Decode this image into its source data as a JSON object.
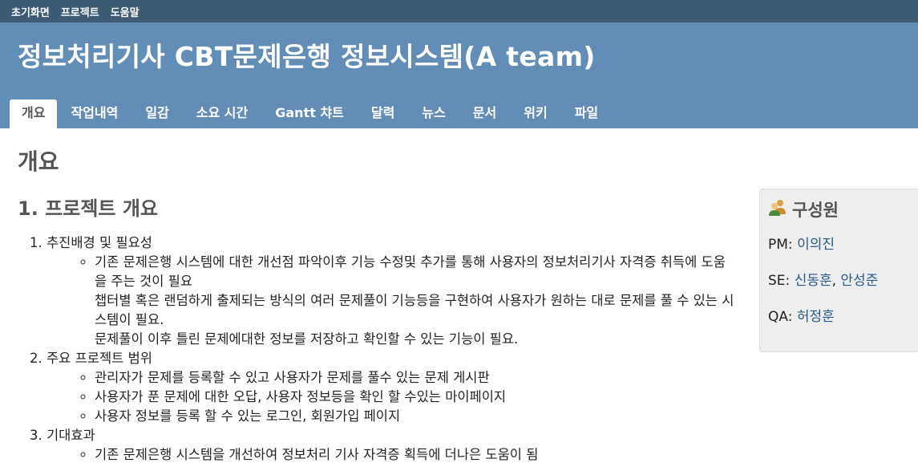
{
  "top_menu": [
    "초기화면",
    "프로젝트",
    "도움말"
  ],
  "header": {
    "title": "정보처리기사 CBT문제은행 정보시스템(A team)"
  },
  "main_menu": {
    "tabs": [
      "개요",
      "작업내역",
      "일감",
      "소요 시간",
      "Gantt 챠트",
      "달력",
      "뉴스",
      "문서",
      "위키",
      "파일"
    ],
    "selected": "개요"
  },
  "content": {
    "page_title": "개요",
    "section_title": "1. 프로젝트 개요",
    "items": [
      {
        "title": "추진배경 및 필요성",
        "bullets": [
          {
            "paragraphs": [
              "기존 문제은행 시스템에 대한 개선점 파악이후 기능 수정및 추가를 통해 사용자의 정보처리기사 자격증 취득에 도움을 주는 것이 필요",
              "챕터별 혹은 랜덤하게 출제되는 방식의 여러 문제풀이 기능등을 구현하여 사용자가 원하는 대로 문제를 풀 수 있는 시스템이 필요.",
              "문제풀이 이후 틀린 문제에대한 정보를 저장하고 확인할 수 있는 기능이 필요."
            ]
          }
        ]
      },
      {
        "title": "주요 프로젝트 범위",
        "bullets": [
          {
            "paragraphs": [
              "관리자가 문제를 등록할 수 있고 사용자가 문제를 풀수 있는 문제 게시판"
            ]
          },
          {
            "paragraphs": [
              "사용자가 푼 문제에 대한 오답, 사용자 정보등을 확인 할 수있는 마이페이지"
            ]
          },
          {
            "paragraphs": [
              "사용자 정보를 등록 할 수 있는 로그인, 회원가입 페이지"
            ]
          }
        ]
      },
      {
        "title": "기대효과",
        "bullets": [
          {
            "paragraphs": [
              "기존 문제은행 시스템을 개선하여 정보처리 기사 자격증 획득에 더나은 도움이 됨"
            ]
          }
        ]
      }
    ]
  },
  "sidebar": {
    "title": "구성원",
    "icon": "members-icon",
    "roles": [
      {
        "role": "PM",
        "members": [
          "이의진"
        ]
      },
      {
        "role": "SE",
        "members": [
          "신동훈",
          "안성준"
        ]
      },
      {
        "role": "QA",
        "members": [
          "허정훈"
        ]
      }
    ]
  },
  "colors": {
    "top_menu_bg": "#3e5b76",
    "header_bg": "#628db6",
    "link": "#2a5a8a",
    "heading": "#555555",
    "sidebar_bg": "#eeeeee"
  }
}
